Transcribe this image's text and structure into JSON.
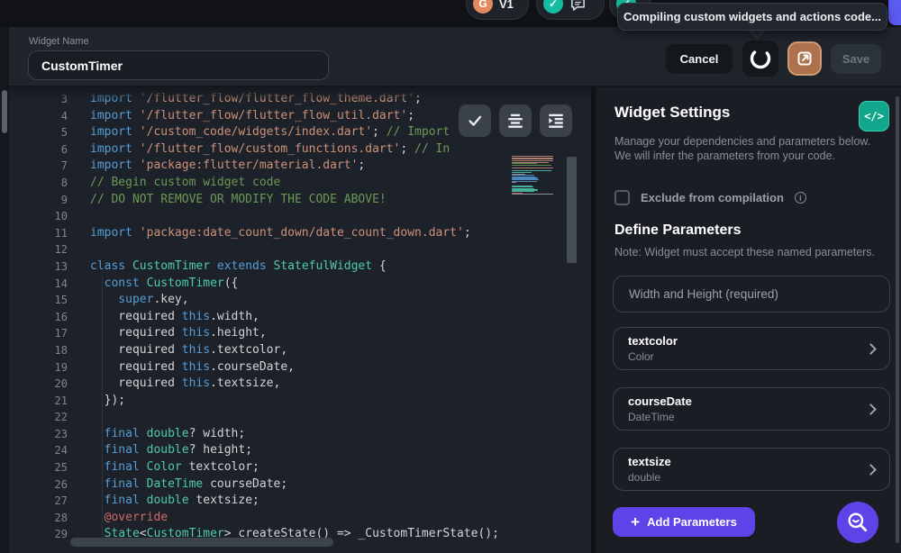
{
  "colors": {
    "purple": "#5d43e8",
    "teal": "#12a78c",
    "orange": "#ad714e",
    "code_keyword": "#569cd6",
    "code_type": "#4ec9b0",
    "code_string": "#ce9178",
    "code_comment": "#6a9955"
  },
  "topbar": {
    "version_pill": {
      "icon": "G",
      "label": "V1"
    },
    "tooltip": "Compiling custom widgets and actions code..."
  },
  "header": {
    "widget_name_label": "Widget Name",
    "widget_name_value": "CustomTimer",
    "cancel_label": "Cancel",
    "save_label": "Save"
  },
  "editor": {
    "lines": [
      {
        "n": 3,
        "tokens": [
          [
            "kw",
            "import"
          ],
          [
            "st",
            " '/flutter_flow/flutter_flow_theme.dart'"
          ],
          [
            "pl",
            ";"
          ]
        ]
      },
      {
        "n": 4,
        "tokens": [
          [
            "kw",
            "import"
          ],
          [
            "st",
            " '/flutter_flow/flutter_flow_util.dart'"
          ],
          [
            "pl",
            ";"
          ]
        ]
      },
      {
        "n": 5,
        "tokens": [
          [
            "kw",
            "import"
          ],
          [
            "st",
            " '/custom_code/widgets/index.dart'"
          ],
          [
            "pl",
            ";"
          ],
          [
            "cm",
            " // Import"
          ]
        ]
      },
      {
        "n": 6,
        "tokens": [
          [
            "kw",
            "import"
          ],
          [
            "st",
            " '/flutter_flow/custom_functions.dart'"
          ],
          [
            "pl",
            ";"
          ],
          [
            "cm",
            " // In"
          ]
        ]
      },
      {
        "n": 7,
        "tokens": [
          [
            "kw",
            "import"
          ],
          [
            "st",
            " 'package:flutter/material.dart'"
          ],
          [
            "pl",
            ";"
          ]
        ]
      },
      {
        "n": 8,
        "tokens": [
          [
            "cm",
            "// Begin custom widget code"
          ]
        ]
      },
      {
        "n": 9,
        "tokens": [
          [
            "cm",
            "// DO NOT REMOVE OR MODIFY THE CODE ABOVE!"
          ]
        ]
      },
      {
        "n": 10,
        "tokens": []
      },
      {
        "n": 11,
        "tokens": [
          [
            "kw",
            "import"
          ],
          [
            "st",
            " 'package:date_count_down/date_count_down.dart'"
          ],
          [
            "pl",
            ";"
          ]
        ]
      },
      {
        "n": 12,
        "tokens": []
      },
      {
        "n": 13,
        "tokens": [
          [
            "kw",
            "class"
          ],
          [
            "ty",
            " CustomTimer"
          ],
          [
            "kw",
            " extends"
          ],
          [
            "ty",
            " StatefulWidget"
          ],
          [
            "pl",
            " {"
          ]
        ]
      },
      {
        "n": 14,
        "tokens": [
          [
            "kw",
            "  const"
          ],
          [
            "ty",
            " CustomTimer"
          ],
          [
            "pl",
            "({"
          ]
        ]
      },
      {
        "n": 15,
        "tokens": [
          [
            "kw",
            "    super"
          ],
          [
            "pl",
            ".key,"
          ]
        ]
      },
      {
        "n": 16,
        "tokens": [
          [
            "pl",
            "    required "
          ],
          [
            "kw",
            "this"
          ],
          [
            "pl",
            ".width,"
          ]
        ]
      },
      {
        "n": 17,
        "tokens": [
          [
            "pl",
            "    required "
          ],
          [
            "kw",
            "this"
          ],
          [
            "pl",
            ".height,"
          ]
        ]
      },
      {
        "n": 18,
        "tokens": [
          [
            "pl",
            "    required "
          ],
          [
            "kw",
            "this"
          ],
          [
            "pl",
            ".textcolor,"
          ]
        ]
      },
      {
        "n": 19,
        "tokens": [
          [
            "pl",
            "    required "
          ],
          [
            "kw",
            "this"
          ],
          [
            "pl",
            ".courseDate,"
          ]
        ]
      },
      {
        "n": 20,
        "tokens": [
          [
            "pl",
            "    required "
          ],
          [
            "kw",
            "this"
          ],
          [
            "pl",
            ".textsize,"
          ]
        ]
      },
      {
        "n": 21,
        "tokens": [
          [
            "pl",
            "  });"
          ]
        ]
      },
      {
        "n": 22,
        "tokens": []
      },
      {
        "n": 23,
        "tokens": [
          [
            "kw",
            "  final"
          ],
          [
            "ty",
            " double"
          ],
          [
            "pl",
            "? width;"
          ]
        ]
      },
      {
        "n": 24,
        "tokens": [
          [
            "kw",
            "  final"
          ],
          [
            "ty",
            " double"
          ],
          [
            "pl",
            "? height;"
          ]
        ]
      },
      {
        "n": 25,
        "tokens": [
          [
            "kw",
            "  final"
          ],
          [
            "ty",
            " Color"
          ],
          [
            "pl",
            " textcolor;"
          ]
        ]
      },
      {
        "n": 26,
        "tokens": [
          [
            "kw",
            "  final"
          ],
          [
            "ty",
            " DateTime"
          ],
          [
            "pl",
            " courseDate;"
          ]
        ]
      },
      {
        "n": 27,
        "tokens": [
          [
            "kw",
            "  final"
          ],
          [
            "ty",
            " double"
          ],
          [
            "pl",
            " textsize;"
          ]
        ]
      },
      {
        "n": 28,
        "tokens": [
          [
            "an",
            "  @override"
          ]
        ]
      },
      {
        "n": 29,
        "tokens": [
          [
            "ty",
            "  State"
          ],
          [
            "pl",
            "<"
          ],
          [
            "ty",
            "CustomTimer"
          ],
          [
            "pl",
            "> createState() => _CustomTimerState();"
          ]
        ]
      }
    ]
  },
  "panel": {
    "title": "Widget Settings",
    "code_button_label": "</>",
    "subtitle_line1": "Manage your dependencies and parameters below.",
    "subtitle_line2": "We will infer the parameters from your code.",
    "exclude_label": "Exclude from compilation",
    "define_title": "Define Parameters",
    "note": "Note: Widget must accept these named parameters.",
    "size_param_label": "Width and Height (required)",
    "params": [
      {
        "name": "textcolor",
        "type": "Color"
      },
      {
        "name": "courseDate",
        "type": "DateTime"
      },
      {
        "name": "textsize",
        "type": "double"
      }
    ],
    "add_button_label": "Add Parameters"
  }
}
